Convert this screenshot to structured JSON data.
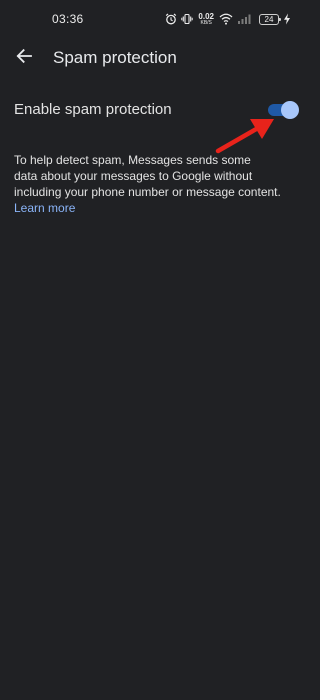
{
  "status_bar": {
    "time": "03:36",
    "net_speed_value": "0.02",
    "net_speed_unit": "KB/S",
    "battery_level": "24",
    "icons": [
      "alarm-icon",
      "vibrate-icon",
      "wifi-icon",
      "signal-icon",
      "charging-icon"
    ]
  },
  "header": {
    "back_icon": "arrow-left-icon",
    "title": "Spam protection"
  },
  "setting": {
    "label": "Enable spam protection",
    "enabled": true
  },
  "description": {
    "lines": [
      "To help detect spam, Messages sends some",
      "data about your messages to Google without",
      "including your phone number or message content."
    ],
    "link": "Learn more"
  },
  "annotation": {
    "arrow_icon": "red-arrow-icon",
    "color": "#e8231b"
  },
  "colors": {
    "background": "#202124",
    "toggle_track": "#1f59a6",
    "toggle_thumb": "#a8c7fa",
    "link": "#8ab4f8"
  }
}
